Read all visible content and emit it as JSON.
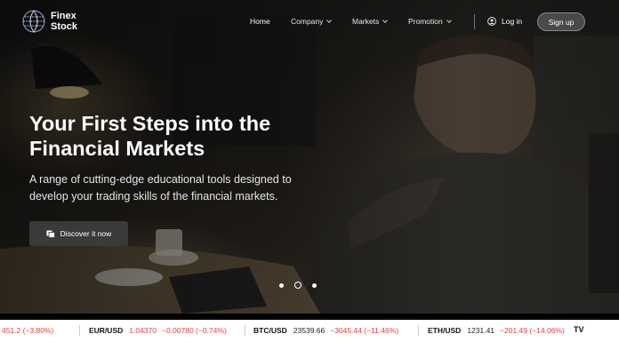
{
  "brand": {
    "line1": "Finex",
    "line2": "Stock"
  },
  "nav": {
    "items": [
      {
        "label": "Home",
        "active": true
      },
      {
        "label": "Company",
        "dropdown": true
      },
      {
        "label": "Markets",
        "dropdown": true
      },
      {
        "label": "Promotion",
        "dropdown": true
      }
    ],
    "login_label": "Log in",
    "signup_label": "Sign up"
  },
  "hero": {
    "title": "Your First Steps into the Financial Markets",
    "subtitle": "A range of cutting-edge educational tools designed to develop your trading skills of the financial markets.",
    "cta_label": "Discover it now",
    "slides": {
      "count": 3,
      "active_index": 1
    }
  },
  "ticker": {
    "items": [
      {
        "symbol": "",
        "price": "",
        "change": "451.2 (−3.80%)"
      },
      {
        "symbol": "EUR/USD",
        "price": "1.04370",
        "change": "−0.00780 (−0.74%)"
      },
      {
        "symbol": "BTC/USD",
        "price": "23539.66",
        "change": "−3045.44 (−11.46%)"
      },
      {
        "symbol": "ETH/USD",
        "price": "1231.41",
        "change": "−201.49 (−14.06%)"
      }
    ],
    "provider_logo": "TV"
  },
  "colors": {
    "negative": "#e04040",
    "accent_white": "#ffffff"
  }
}
